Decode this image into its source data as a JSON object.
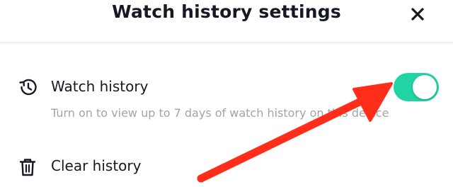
{
  "header": {
    "title": "Watch history settings",
    "close_icon": "close-icon"
  },
  "settings": {
    "watch_history": {
      "label": "Watch history",
      "description": "Turn on to view up to 7 days of watch history on this device",
      "icon": "history-clock-icon",
      "enabled": true
    },
    "clear_history": {
      "label": "Clear history",
      "icon": "trash-icon"
    }
  },
  "colors": {
    "toggle_on": "#20d5a3",
    "annotation_arrow": "#ff2d1a",
    "text_primary": "#161823",
    "text_secondary": "#a3a4a8"
  }
}
